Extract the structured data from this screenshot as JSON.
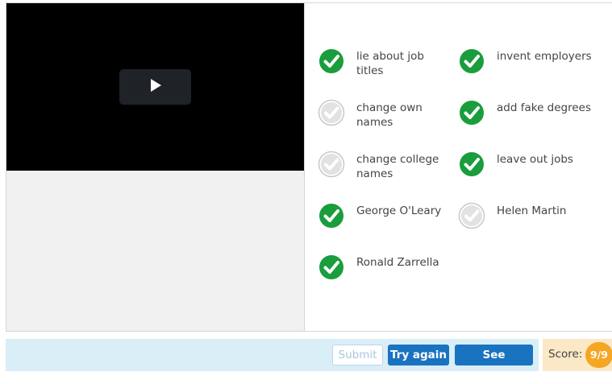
{
  "video": {
    "play_icon": "play-icon"
  },
  "options": [
    {
      "label": "lie about job titles",
      "state": "correct"
    },
    {
      "label": "invent employers",
      "state": "correct"
    },
    {
      "label": "change own names",
      "state": "unselected"
    },
    {
      "label": "add fake degrees",
      "state": "correct"
    },
    {
      "label": "change college names",
      "state": "unselected"
    },
    {
      "label": "leave out jobs",
      "state": "correct"
    },
    {
      "label": "George O'Leary",
      "state": "correct"
    },
    {
      "label": "Helen Martin",
      "state": "unselected"
    },
    {
      "label": "Ronald Zarrella",
      "state": "correct"
    }
  ],
  "actions": {
    "submit_label": "Submit",
    "try_again_label": "Try again",
    "see_answers_label": "See answers"
  },
  "score": {
    "label": "Score:",
    "value": "9/9"
  },
  "colors": {
    "correct": "#1a9d3c",
    "unselected_ring": "#c8c8c8",
    "button": "#1a73c0",
    "score_badge": "#f5a623"
  }
}
